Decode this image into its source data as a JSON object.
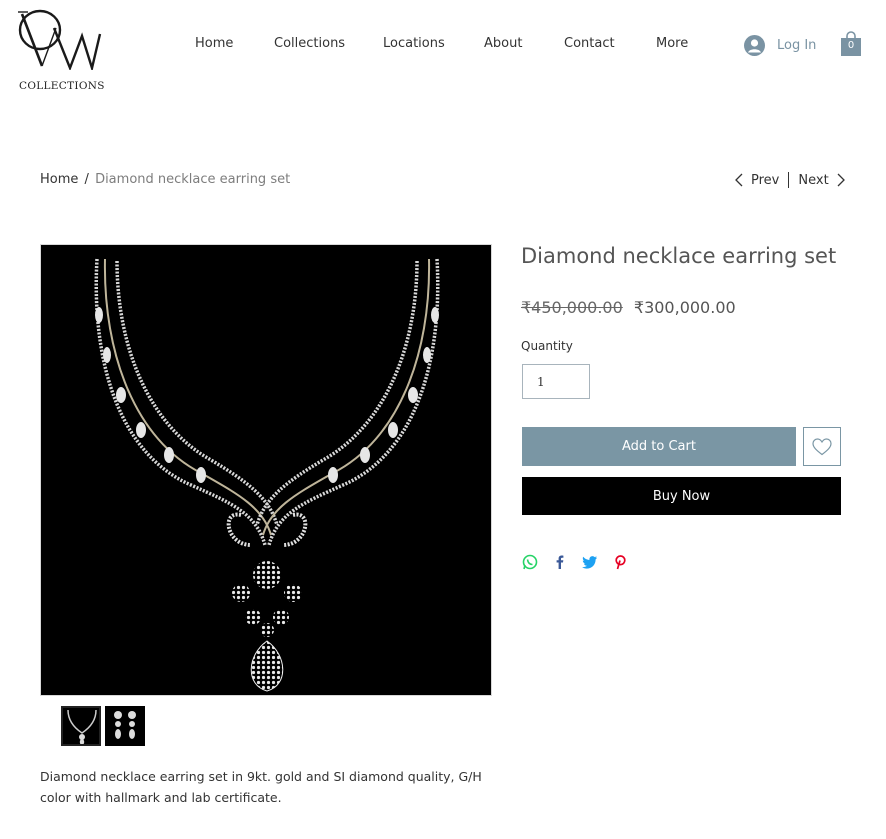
{
  "brand": {
    "logo_text": "COLLECTIONS"
  },
  "nav": {
    "items": [
      {
        "label": "Home"
      },
      {
        "label": "Collections"
      },
      {
        "label": "Locations"
      },
      {
        "label": "About"
      },
      {
        "label": "Contact"
      },
      {
        "label": "More"
      }
    ]
  },
  "header": {
    "login_label": "Log In",
    "cart_count": "0",
    "user_icon": "user-avatar-icon",
    "cart_icon": "shopping-bag-icon"
  },
  "breadcrumb": {
    "home": "Home",
    "separator": "/",
    "current": "Diamond necklace earring set"
  },
  "pager": {
    "prev": "Prev",
    "next": "Next"
  },
  "product": {
    "title": "Diamond necklace earring set",
    "price_old": "₹450,000.00",
    "price_new": "₹300,000.00",
    "quantity_label": "Quantity",
    "quantity_value": "1",
    "add_to_cart": "Add to Cart",
    "buy_now": "Buy Now",
    "description": "Diamond necklace earring set in 9kt. gold and SI diamond quality, G/H color with hallmark and lab certificate."
  },
  "share": {
    "icons": [
      "whatsapp-icon",
      "facebook-icon",
      "twitter-icon",
      "pinterest-icon"
    ]
  },
  "colors": {
    "accent": "#7a96a4",
    "buy_now_bg": "#000000",
    "whatsapp": "#25d366",
    "facebook": "#3b5998",
    "twitter": "#1da1f2",
    "pinterest": "#e60023"
  }
}
